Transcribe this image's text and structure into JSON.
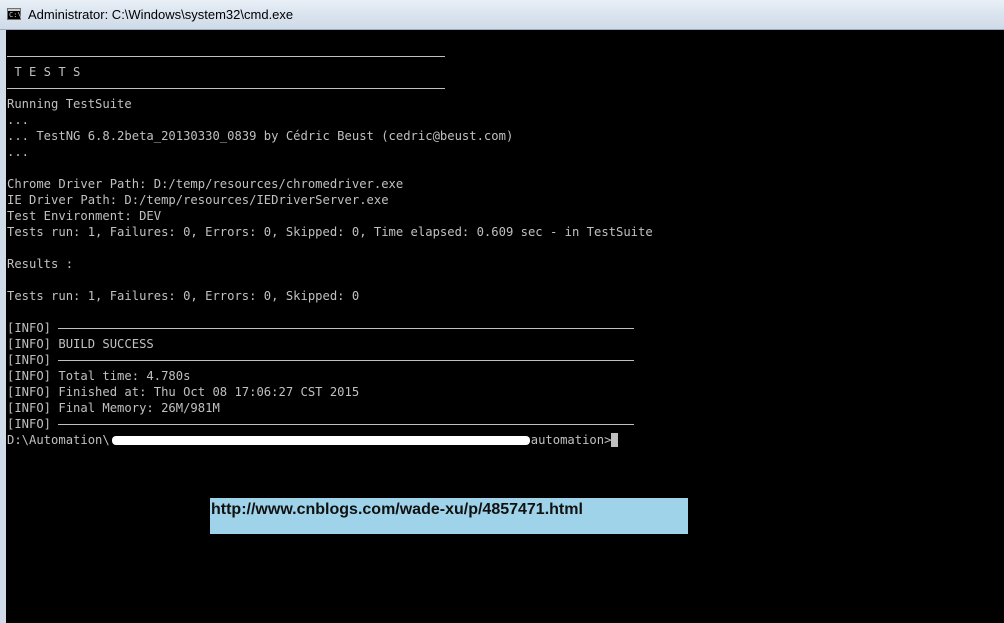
{
  "window": {
    "title": "Administrator: C:\\Windows\\system32\\cmd.exe",
    "icon": "cmd-icon",
    "icon_glyph": "C:\\"
  },
  "console": {
    "lines": [
      {
        "type": "rule"
      },
      {
        "type": "text",
        "text": " T E S T S"
      },
      {
        "type": "rule"
      },
      {
        "type": "text",
        "text": "Running TestSuite"
      },
      {
        "type": "text",
        "text": "..."
      },
      {
        "type": "text",
        "text": "... TestNG 6.8.2beta_20130330_0839 by Cédric Beust (cedric@beust.com)"
      },
      {
        "type": "text",
        "text": "..."
      },
      {
        "type": "text",
        "text": ""
      },
      {
        "type": "text",
        "text": "Chrome Driver Path: D:/temp/resources/chromedriver.exe"
      },
      {
        "type": "text",
        "text": "IE Driver Path: D:/temp/resources/IEDriverServer.exe"
      },
      {
        "type": "text",
        "text": "Test Environment: DEV"
      },
      {
        "type": "text",
        "text": "Tests run: 1, Failures: 0, Errors: 0, Skipped: 0, Time elapsed: 0.609 sec - in TestSuite"
      },
      {
        "type": "text",
        "text": ""
      },
      {
        "type": "text",
        "text": "Results :"
      },
      {
        "type": "text",
        "text": ""
      },
      {
        "type": "text",
        "text": "Tests run: 1, Failures: 0, Errors: 0, Skipped: 0"
      },
      {
        "type": "text",
        "text": ""
      },
      {
        "type": "inforule",
        "text": "[INFO] "
      },
      {
        "type": "text",
        "text": "[INFO] BUILD SUCCESS"
      },
      {
        "type": "inforule",
        "text": "[INFO] "
      },
      {
        "type": "text",
        "text": "[INFO] Total time: 4.780s"
      },
      {
        "type": "text",
        "text": "[INFO] Finished at: Thu Oct 08 17:06:27 CST 2015"
      },
      {
        "type": "text",
        "text": "[INFO] Final Memory: 26M/981M"
      },
      {
        "type": "inforule",
        "text": "[INFO] "
      },
      {
        "type": "prompt",
        "prefix": "D:\\Automation\\",
        "suffix": "automation>"
      }
    ]
  },
  "watermark": {
    "text": "http://www.cnblogs.com/wade-xu/p/4857471.html"
  },
  "colors": {
    "console_bg": "#000000",
    "console_fg": "#c0c0c0",
    "watermark_bg": "#9ed3ea"
  }
}
